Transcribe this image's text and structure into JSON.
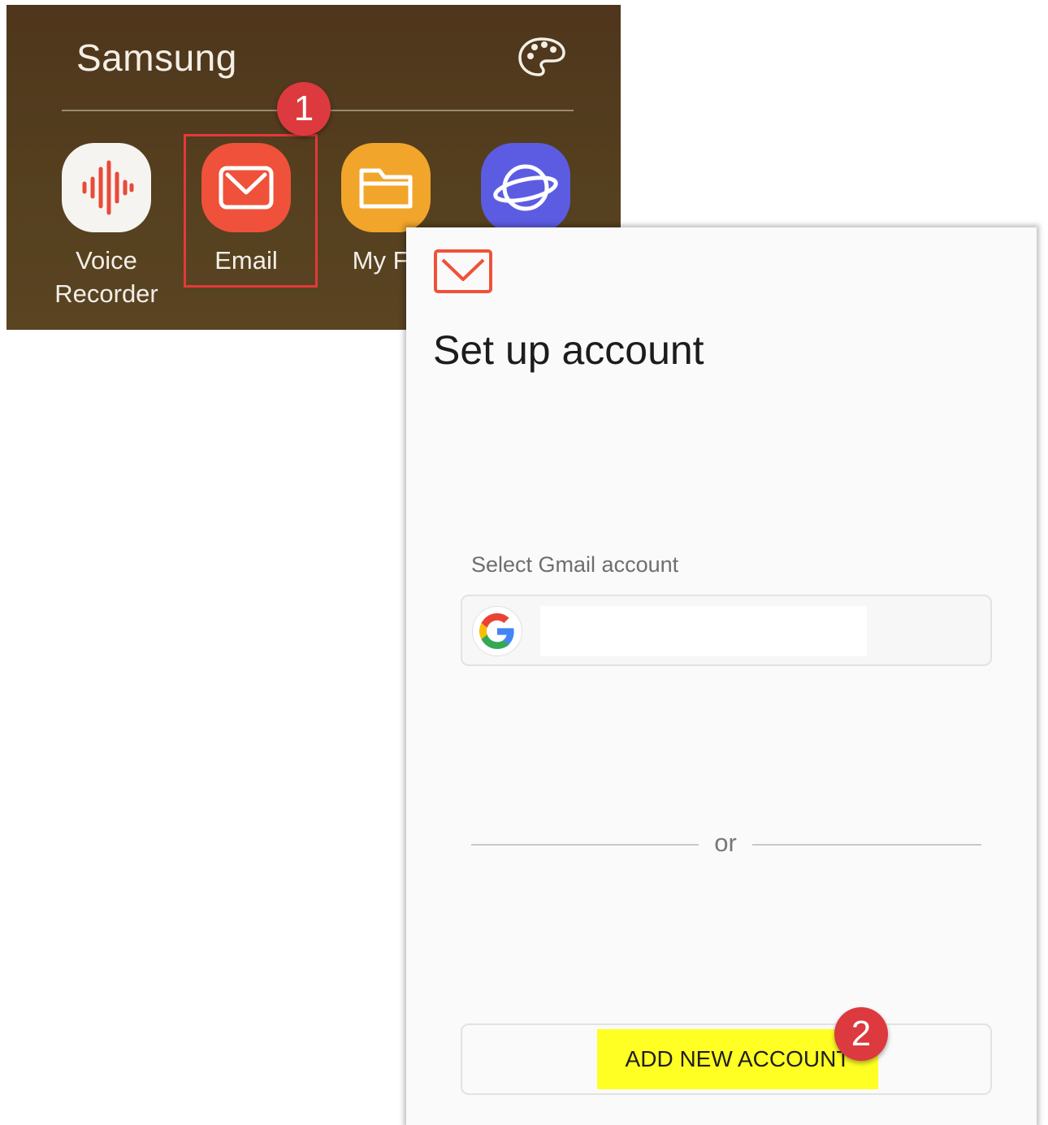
{
  "launcher": {
    "folder_title": "Samsung",
    "palette_icon": "palette-icon",
    "apps": [
      {
        "name_line1": "Voice",
        "name_line2": "Recorder",
        "icon": "voice-recorder-icon",
        "color": "#f6f4f1"
      },
      {
        "name_line1": "Email",
        "name_line2": "",
        "icon": "email-icon",
        "color": "#f0513a"
      },
      {
        "name_line1": "My Fil",
        "name_line2": "",
        "icon": "my-files-icon",
        "color": "#f1a52b"
      },
      {
        "name_line1": "",
        "name_line2": "",
        "icon": "samsung-internet-icon",
        "color": "#5c5ce3"
      }
    ]
  },
  "annotations": {
    "step1": "1",
    "step2": "2",
    "highlight_color": "#e3393a",
    "badge_color": "#dc3a3e"
  },
  "setup": {
    "title": "Set up account",
    "gmail_label": "Select Gmail account",
    "gmail_value": "",
    "or_text": "or",
    "add_account_label": "ADD NEW ACCOUNT",
    "highlight_color": "#ffff24"
  }
}
